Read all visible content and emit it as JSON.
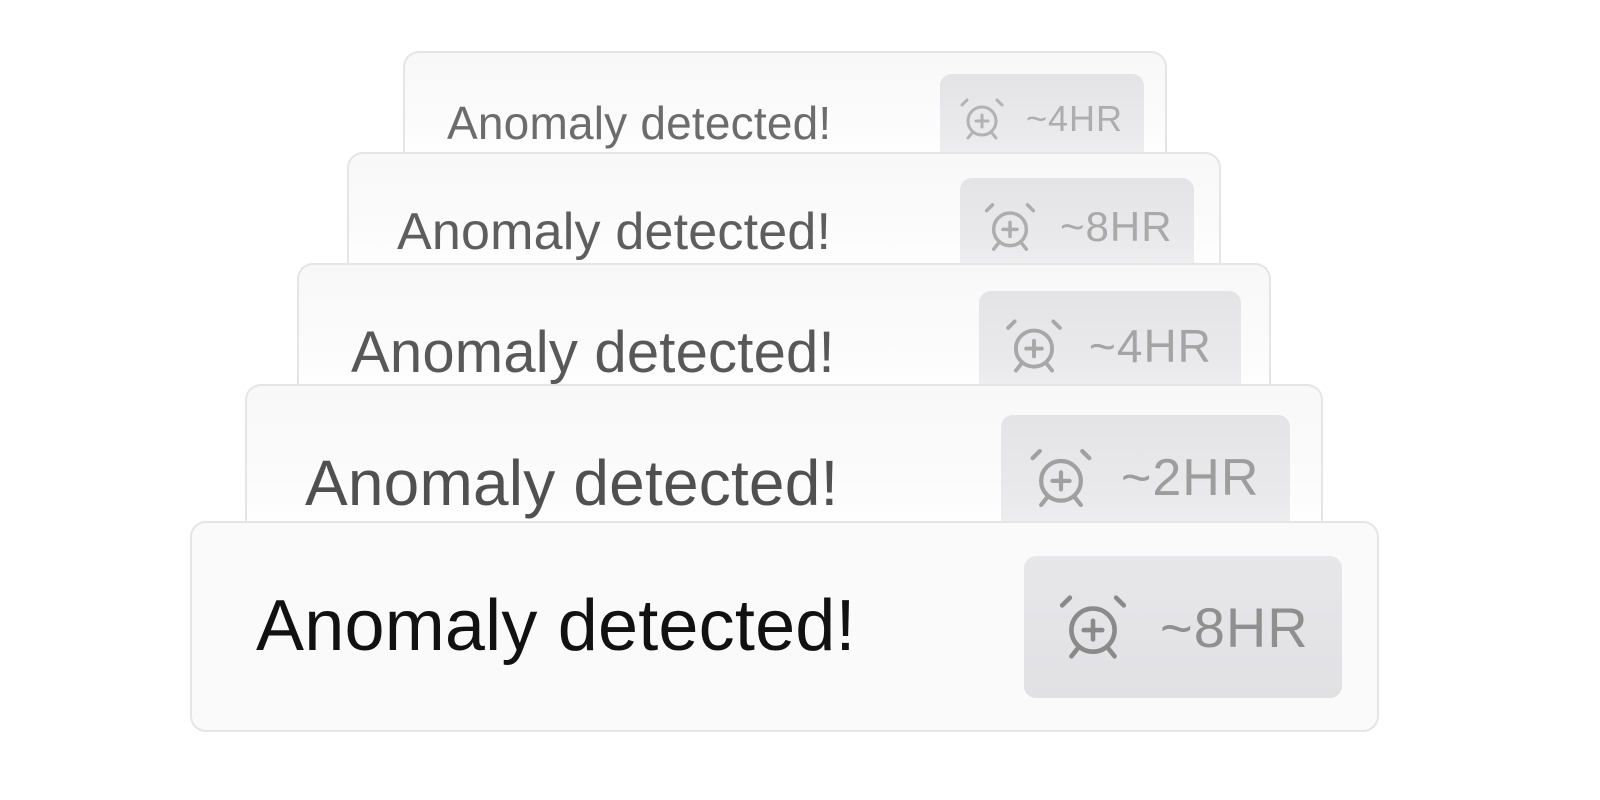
{
  "alerts": [
    {
      "title": "Anomaly detected!",
      "eta": "~4HR",
      "icon": "alarm-clock-plus-icon"
    },
    {
      "title": "Anomaly detected!",
      "eta": "~8HR",
      "icon": "alarm-clock-plus-icon"
    },
    {
      "title": "Anomaly detected!",
      "eta": "~4HR",
      "icon": "alarm-clock-plus-icon"
    },
    {
      "title": "Anomaly detected!",
      "eta": "~2HR",
      "icon": "alarm-clock-plus-icon"
    },
    {
      "title": "Anomaly detected!",
      "eta": "~8HR",
      "icon": "alarm-clock-plus-icon"
    }
  ]
}
